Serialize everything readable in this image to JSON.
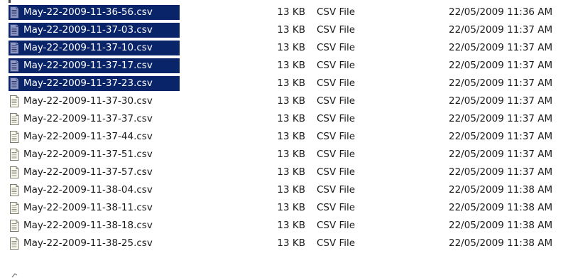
{
  "file_list": {
    "rows": [
      {
        "name": "May-22-2009-11-36-56.csv",
        "size": "13 KB",
        "type": "CSV File",
        "modified": "22/05/2009 11:36 AM",
        "selected": true
      },
      {
        "name": "May-22-2009-11-37-03.csv",
        "size": "13 KB",
        "type": "CSV File",
        "modified": "22/05/2009 11:37 AM",
        "selected": true
      },
      {
        "name": "May-22-2009-11-37-10.csv",
        "size": "13 KB",
        "type": "CSV File",
        "modified": "22/05/2009 11:37 AM",
        "selected": true
      },
      {
        "name": "May-22-2009-11-37-17.csv",
        "size": "13 KB",
        "type": "CSV File",
        "modified": "22/05/2009 11:37 AM",
        "selected": true
      },
      {
        "name": "May-22-2009-11-37-23.csv",
        "size": "13 KB",
        "type": "CSV File",
        "modified": "22/05/2009 11:37 AM",
        "selected": true
      },
      {
        "name": "May-22-2009-11-37-30.csv",
        "size": "13 KB",
        "type": "CSV File",
        "modified": "22/05/2009 11:37 AM",
        "selected": false
      },
      {
        "name": "May-22-2009-11-37-37.csv",
        "size": "13 KB",
        "type": "CSV File",
        "modified": "22/05/2009 11:37 AM",
        "selected": false
      },
      {
        "name": "May-22-2009-11-37-44.csv",
        "size": "13 KB",
        "type": "CSV File",
        "modified": "22/05/2009 11:37 AM",
        "selected": false
      },
      {
        "name": "May-22-2009-11-37-51.csv",
        "size": "13 KB",
        "type": "CSV File",
        "modified": "22/05/2009 11:37 AM",
        "selected": false
      },
      {
        "name": "May-22-2009-11-37-57.csv",
        "size": "13 KB",
        "type": "CSV File",
        "modified": "22/05/2009 11:37 AM",
        "selected": false
      },
      {
        "name": "May-22-2009-11-38-04.csv",
        "size": "13 KB",
        "type": "CSV File",
        "modified": "22/05/2009 11:38 AM",
        "selected": false
      },
      {
        "name": "May-22-2009-11-38-11.csv",
        "size": "13 KB",
        "type": "CSV File",
        "modified": "22/05/2009 11:38 AM",
        "selected": false
      },
      {
        "name": "May-22-2009-11-38-18.csv",
        "size": "13 KB",
        "type": "CSV File",
        "modified": "22/05/2009 11:38 AM",
        "selected": false
      },
      {
        "name": "May-22-2009-11-38-25.csv",
        "size": "13 KB",
        "type": "CSV File",
        "modified": "22/05/2009 11:38 AM",
        "selected": false
      }
    ],
    "file_icon": "csv-text-file-icon"
  },
  "colors": {
    "selection_background": "#0a246a",
    "selected_text": "#ffffff",
    "normal_text": "#1a1a1a",
    "window_background": "#ffffff"
  }
}
